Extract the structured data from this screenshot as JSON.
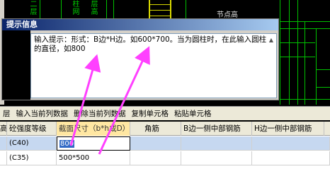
{
  "cad": {
    "vtexts": [
      "二层",
      "柱网",
      "层高"
    ],
    "label_node": "节点高"
  },
  "dialog": {
    "title": "提示信息",
    "message": "输入提示：形式：B边*H边。如600*700。当为圆柱时，在此输入圆柱的直径，如800"
  },
  "toolbar": {
    "items": [
      "层",
      "输入当前列数据",
      "删除当前列数据",
      "复制单元格",
      "粘贴单元格"
    ]
  },
  "table": {
    "columns": [
      "高",
      "砼强度等级",
      "截面尺寸（b*h或D）",
      "角筋",
      "B边一侧中部钢筋",
      "H边一侧中部钢筋"
    ],
    "rows": [
      {
        "grade": "(C40)",
        "section": "800",
        "corner": "",
        "b_mid": "",
        "h_mid": ""
      },
      {
        "grade": "(C35)",
        "section": "500*500",
        "corner": "",
        "b_mid": "",
        "h_mid": ""
      }
    ]
  },
  "colors": {
    "arrow": "#ff40ff",
    "header_active": "#ffe7a2",
    "row_selected": "#c6d8f0",
    "cad_green": "#00c000"
  }
}
